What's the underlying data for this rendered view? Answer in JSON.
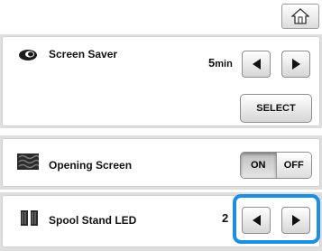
{
  "header": {
    "home_icon": "home-icon"
  },
  "screen_saver": {
    "label": "Screen Saver",
    "icon": "eye-icon",
    "value_number": "5",
    "value_unit": "min",
    "select_label": "SELECT"
  },
  "opening_screen": {
    "label": "Opening Screen",
    "icon": "fabric-icon",
    "on_label": "ON",
    "off_label": "OFF",
    "state": "ON"
  },
  "spool_stand_led": {
    "label": "Spool Stand LED",
    "icon": "spool-icon",
    "value": "2"
  },
  "colors": {
    "highlight": "#1e8fe0",
    "strip": "#dedede"
  }
}
